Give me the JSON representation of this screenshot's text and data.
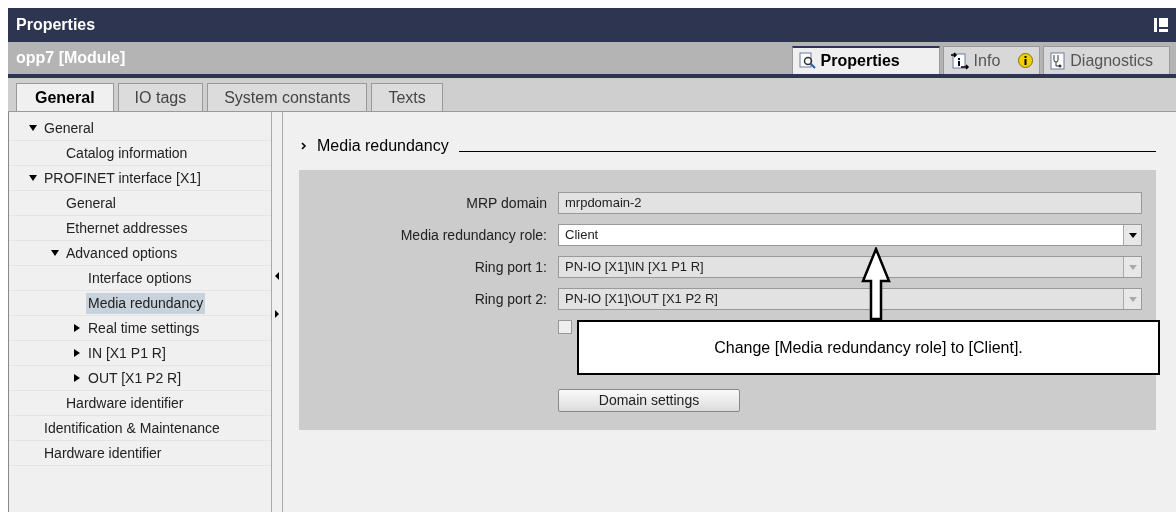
{
  "window": {
    "title": "Properties"
  },
  "object_bar": {
    "title": "opp7 [Module]"
  },
  "view_tabs": [
    {
      "label": "Properties",
      "kind": "properties",
      "selected": true
    },
    {
      "label": "Info",
      "kind": "info",
      "selected": false
    },
    {
      "label": "Diagnostics",
      "kind": "diagnostics",
      "selected": false
    }
  ],
  "tabs": [
    {
      "label": "General",
      "selected": true
    },
    {
      "label": "IO tags",
      "selected": false
    },
    {
      "label": "System constants",
      "selected": false
    },
    {
      "label": "Texts",
      "selected": false
    }
  ],
  "tree": [
    {
      "label": "General",
      "expanded": true,
      "selected": false,
      "children": [
        {
          "label": "Catalog information",
          "selected": false
        }
      ]
    },
    {
      "label": "PROFINET interface [X1]",
      "expanded": true,
      "selected": false,
      "children": [
        {
          "label": "General",
          "selected": false
        },
        {
          "label": "Ethernet addresses",
          "selected": false
        },
        {
          "label": "Advanced options",
          "expanded": true,
          "selected": false,
          "children": [
            {
              "label": "Interface options",
              "selected": false
            },
            {
              "label": "Media redundancy",
              "selected": true
            },
            {
              "label": "Real time settings",
              "expanded": false,
              "selected": false
            },
            {
              "label": "IN [X1 P1 R]",
              "expanded": false,
              "selected": false
            },
            {
              "label": "OUT [X1 P2 R]",
              "expanded": false,
              "selected": false
            }
          ]
        },
        {
          "label": "Hardware identifier",
          "selected": false
        }
      ]
    },
    {
      "label": "Identification & Maintenance",
      "selected": false
    },
    {
      "label": "Hardware identifier",
      "selected": false
    }
  ],
  "section": {
    "title": "Media redundancy"
  },
  "fields": [
    {
      "label": "MRP domain",
      "value": "mrpdomain-2",
      "kind": "text",
      "disabled": true
    },
    {
      "label": "Media redundancy role:",
      "value": "Client",
      "kind": "dropdown",
      "disabled": false
    },
    {
      "label": "Ring port 1:",
      "value": "PN-IO [X1]\\IN [X1 P1 R]",
      "kind": "dropdown",
      "disabled": true
    },
    {
      "label": "Ring port 2:",
      "value": "PN-IO [X1]\\OUT [X1 P2 R]",
      "kind": "dropdown",
      "disabled": true
    }
  ],
  "checkbox": {
    "checked": false
  },
  "button": {
    "label": "Domain settings"
  },
  "callout": {
    "text": "Change [Media redundancy role] to [Client]."
  }
}
